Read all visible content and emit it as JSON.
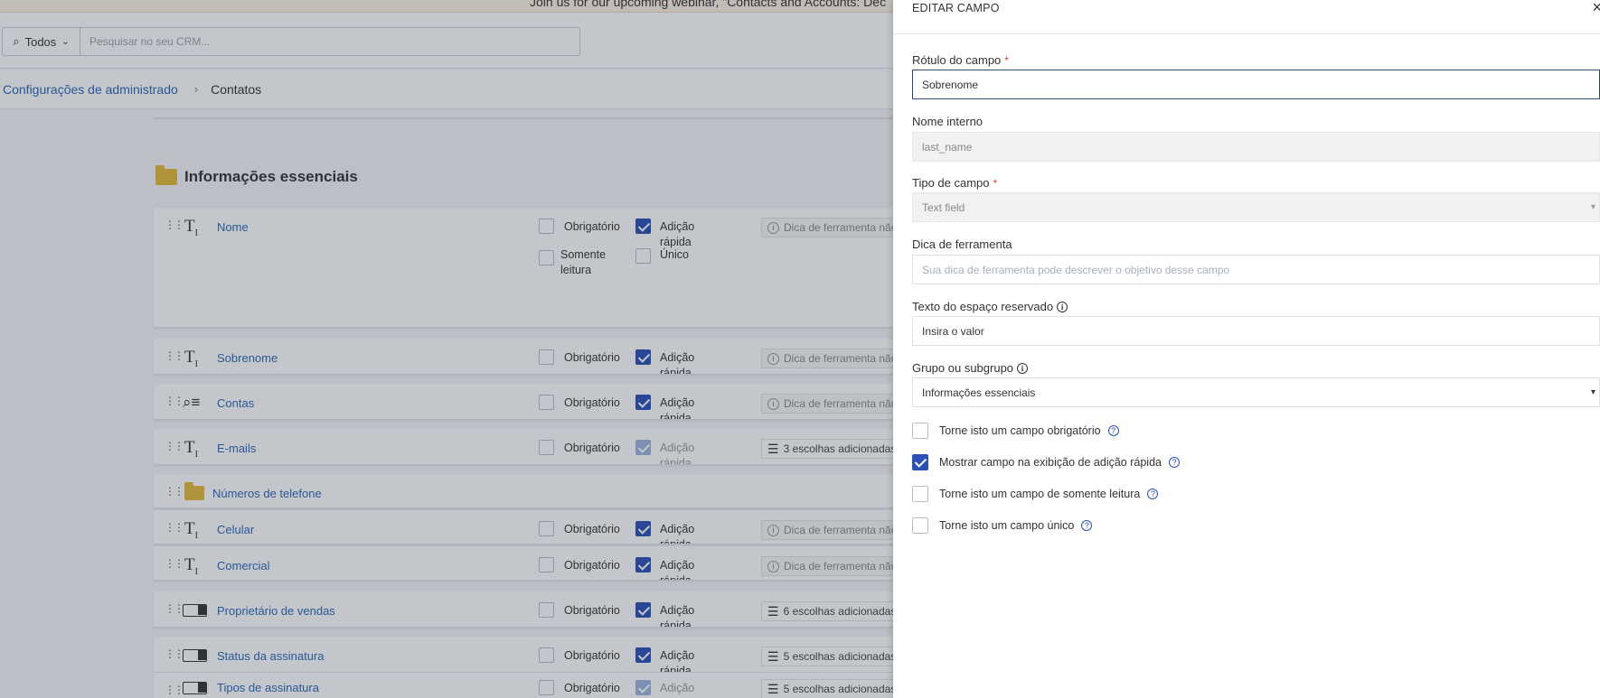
{
  "banner": {
    "text": "Join us for our upcoming webinar, \"Contacts and Accounts: Dec"
  },
  "topbar": {
    "scope_label": "Todos",
    "search_placeholder": "Pesquisar no seu CRM..."
  },
  "breadcrumb": {
    "parent": "Configurações de administrado",
    "current": "Contatos"
  },
  "section": {
    "title": "Informações essenciais"
  },
  "labels": {
    "required": "Obrigatório",
    "quick_add_1": "Adição",
    "quick_add_2": "rápida",
    "read_only_1": "Somente",
    "read_only_2": "leitura",
    "unique": "Único",
    "tooltip_missing": "Dica de ferramenta não"
  },
  "fields": [
    {
      "name": "Nome",
      "icon": "text-field-icon",
      "tooltip": "Dica de ferramenta não"
    },
    {
      "name": "Sobrenome",
      "icon": "text-field-icon",
      "tooltip": "Dica de ferramenta não"
    },
    {
      "name": "Contas",
      "icon": "lookup-icon",
      "tooltip": "Dica de ferramenta não"
    },
    {
      "name": "E-mails",
      "icon": "text-field-icon",
      "tooltip": "3 escolhas adicionadas"
    },
    {
      "name": "Números de telefone",
      "icon": "folder-icon"
    },
    {
      "name": "Celular",
      "icon": "text-field-icon",
      "tooltip": "Dica de ferramenta não"
    },
    {
      "name": "Comercial",
      "icon": "text-field-icon",
      "tooltip": "Dica de ferramenta não"
    },
    {
      "name": "Proprietário de vendas",
      "icon": "dropdown-field-icon",
      "tooltip": "6 escolhas adicionadas"
    },
    {
      "name": "Status da assinatura",
      "icon": "dropdown-field-icon",
      "tooltip": "5 escolhas adicionadas"
    },
    {
      "name": "Tipos de assinatura",
      "icon": "dropdown-field-icon",
      "tooltip": "5 escolhas adicionadas"
    }
  ],
  "panel": {
    "title": "EDITAR CAMPO",
    "close": "×",
    "field_label": {
      "label": "Rótulo do campo",
      "required_mark": "*",
      "value": "Sobrenome"
    },
    "internal_name": {
      "label": "Nome interno",
      "value": "last_name"
    },
    "field_type": {
      "label": "Tipo de campo",
      "required_mark": "*",
      "value": "Text field"
    },
    "tooltip": {
      "label": "Dica de ferramenta",
      "placeholder": "Sua dica de ferramenta pode descrever o objetivo desse campo"
    },
    "placeholder_text": {
      "label": "Texto do espaço reservado",
      "value": "Insira o valor"
    },
    "group": {
      "label": "Grupo ou subgrupo",
      "value": "Informações essenciais"
    },
    "checkboxes": [
      {
        "label": "Torne isto um campo obrigatório",
        "checked": false
      },
      {
        "label": "Mostrar campo na exibição de adição rápida",
        "checked": true
      },
      {
        "label": "Torne isto um campo de somente leitura",
        "checked": false
      },
      {
        "label": "Torne isto um campo único",
        "checked": false
      }
    ]
  },
  "colors": {
    "accent": "#2b50b8",
    "link": "#2f67b8",
    "folder": "#e6b93a"
  }
}
